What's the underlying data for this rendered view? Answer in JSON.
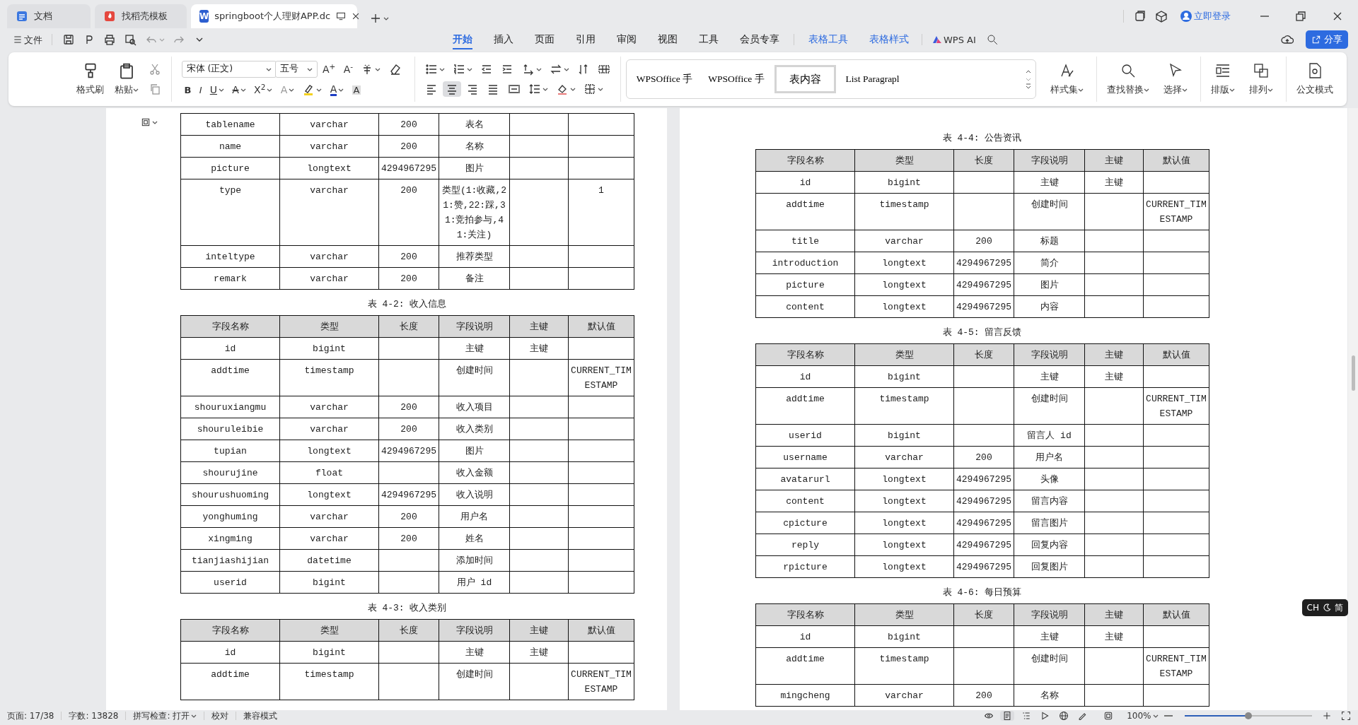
{
  "tabs": [
    {
      "label": "文档",
      "kind": "docs",
      "selected": false
    },
    {
      "label": "找稻壳模板",
      "kind": "docer",
      "selected": false
    },
    {
      "label": "springboot个人理财APP.dc",
      "kind": "word",
      "badge": "W",
      "selected": true
    }
  ],
  "account": {
    "login": "立即登录"
  },
  "file_menu": "文件",
  "menu_tabs": [
    {
      "label": "开始",
      "kind": "main",
      "selected": true
    },
    {
      "label": "插入",
      "kind": "main",
      "selected": false
    },
    {
      "label": "页面",
      "kind": "main",
      "selected": false
    },
    {
      "label": "引用",
      "kind": "main",
      "selected": false
    },
    {
      "label": "审阅",
      "kind": "main",
      "selected": false
    },
    {
      "label": "视图",
      "kind": "main",
      "selected": false
    },
    {
      "label": "工具",
      "kind": "main",
      "selected": false
    },
    {
      "label": "会员专享",
      "kind": "main",
      "selected": false
    },
    {
      "label": "表格工具",
      "kind": "context",
      "selected": false
    },
    {
      "label": "表格样式",
      "kind": "context",
      "selected": false
    }
  ],
  "ai": "WPS AI",
  "share": "分享",
  "ribbon": {
    "format_painter": "格式刷",
    "paste": "粘贴",
    "font_family": "宋体 (正文)",
    "font_size": "五号",
    "font_row1": [
      {
        "kind": "grow",
        "glyph": "A$^{+}$",
        "dropdown": false
      },
      {
        "kind": "shrink",
        "glyph": "A$^{-}$",
        "dropdown": false
      },
      {
        "kind": "phonetic",
        "dropdown": true
      },
      {
        "kind": "eraser",
        "dropdown": false
      }
    ],
    "font_row2": [
      {
        "kind": "bold",
        "glyph": "B",
        "dropdown": false
      },
      {
        "kind": "italic",
        "glyph": "I",
        "dropdown": false
      },
      {
        "kind": "underline",
        "glyph": "U",
        "dropdown": true
      },
      {
        "kind": "strike",
        "glyph": "A",
        "dropdown": true
      },
      {
        "kind": "superscript",
        "glyph": "X$^{2}$",
        "dropdown": true
      },
      {
        "kind": "effects",
        "glyph": "A",
        "dropdown": true
      },
      {
        "kind": "highlight",
        "dropdown": true
      },
      {
        "kind": "font-color",
        "glyph": "A",
        "dropdown": true
      },
      {
        "kind": "shading",
        "glyph": "A",
        "dropdown": false
      }
    ],
    "para_row1": [
      {
        "kind": "bullets",
        "dropdown": true
      },
      {
        "kind": "numbering",
        "dropdown": true
      },
      {
        "kind": "outdent",
        "dropdown": false
      },
      {
        "kind": "indent",
        "dropdown": false
      },
      {
        "kind": "text-direction",
        "dropdown": true
      },
      {
        "kind": "swap",
        "dropdown": true
      },
      {
        "kind": "sort",
        "dropdown": false
      },
      {
        "kind": "table-grid",
        "dropdown": false
      }
    ],
    "para_row2": [
      {
        "kind": "align-left",
        "dropdown": false,
        "selected": false
      },
      {
        "kind": "align-center",
        "dropdown": false,
        "selected": true
      },
      {
        "kind": "align-right",
        "dropdown": false,
        "selected": false
      },
      {
        "kind": "justify",
        "dropdown": false,
        "selected": false
      },
      {
        "kind": "distribute",
        "dropdown": false,
        "selected": false
      },
      {
        "kind": "line-spacing",
        "dropdown": true,
        "selected": false
      },
      {
        "kind": "fill",
        "dropdown": true,
        "selected": false
      },
      {
        "kind": "border",
        "dropdown": true,
        "selected": false
      }
    ],
    "styles": [
      {
        "label": "WPSOffice 手",
        "selected": false
      },
      {
        "label": "WPSOffice 手",
        "selected": false
      },
      {
        "label": "表内容",
        "selected": true
      },
      {
        "label": "List Paragrapl",
        "selected": false
      }
    ],
    "big_tools": [
      {
        "kind": "style-set",
        "label": "样式集",
        "dropdown": true
      },
      {
        "kind": "find-replace",
        "label": "查找替换",
        "dropdown": true
      },
      {
        "kind": "select",
        "label": "选择",
        "dropdown": true
      },
      {
        "kind": "layout",
        "label": "排版",
        "dropdown": true
      },
      {
        "kind": "arrange",
        "label": "排列",
        "dropdown": true
      },
      {
        "kind": "official",
        "label": "公文模式",
        "dropdown": false
      }
    ]
  },
  "pages": [
    {
      "blocks": [
        {
          "kind": "table",
          "rows": [
            [
              "tablename",
              "varchar",
              "200",
              "表名",
              null,
              null
            ],
            [
              "name",
              "varchar",
              "200",
              "名称",
              null,
              null
            ],
            [
              "picture",
              "longtext",
              "4294967295",
              "图片",
              null,
              null
            ],
            [
              "type",
              "varchar",
              "200",
              "类型(1:收藏,21:赞,22:踩,31:竞拍参与,41:关注)",
              null,
              "1"
            ],
            [
              "inteltype",
              "varchar",
              "200",
              "推荐类型",
              null,
              null
            ],
            [
              "remark",
              "varchar",
              "200",
              "备注",
              null,
              null
            ]
          ]
        },
        {
          "kind": "caption",
          "text": "表 4-2: 收入信息"
        },
        {
          "kind": "table",
          "columns": [
            "字段名称",
            "类型",
            "长度",
            "字段说明",
            "主键",
            "默认值"
          ],
          "rows": [
            [
              "id",
              "bigint",
              null,
              "主键",
              "主键",
              null
            ],
            [
              "addtime",
              "timestamp",
              null,
              "创建时间",
              null,
              "CURRENT_TIMESTAMP"
            ],
            [
              "shouruxiangmu",
              "varchar",
              "200",
              "收入项目",
              null,
              null
            ],
            [
              "shouruleibie",
              "varchar",
              "200",
              "收入类别",
              null,
              null
            ],
            [
              "tupian",
              "longtext",
              "4294967295",
              "图片",
              null,
              null
            ],
            [
              "shourujine",
              "float",
              null,
              "收入金额",
              null,
              null
            ],
            [
              "shourushuoming",
              "longtext",
              "4294967295",
              "收入说明",
              null,
              null
            ],
            [
              "yonghuming",
              "varchar",
              "200",
              "用户名",
              null,
              null
            ],
            [
              "xingming",
              "varchar",
              "200",
              "姓名",
              null,
              null
            ],
            [
              "tianjiashijian",
              "datetime",
              null,
              "添加时间",
              null,
              null
            ],
            [
              "userid",
              "bigint",
              null,
              "用户 id",
              null,
              null
            ]
          ]
        },
        {
          "kind": "caption",
          "text": "表 4-3: 收入类别"
        },
        {
          "kind": "table",
          "columns": [
            "字段名称",
            "类型",
            "长度",
            "字段说明",
            "主键",
            "默认值"
          ],
          "rows": [
            [
              "id",
              "bigint",
              null,
              "主键",
              "主键",
              null
            ],
            [
              "addtime",
              "timestamp",
              null,
              "创建时间",
              null,
              "CURRENT_TIMESTAMP"
            ]
          ]
        }
      ]
    },
    {
      "blocks": [
        {
          "kind": "caption",
          "text": "表 4-4: 公告资讯"
        },
        {
          "kind": "table",
          "columns": [
            "字段名称",
            "类型",
            "长度",
            "字段说明",
            "主键",
            "默认值"
          ],
          "rows": [
            [
              "id",
              "bigint",
              null,
              "主键",
              "主键",
              null
            ],
            [
              "addtime",
              "timestamp",
              null,
              "创建时间",
              null,
              "CURRENT_TIMESTAMP"
            ],
            [
              "title",
              "varchar",
              "200",
              "标题",
              null,
              null
            ],
            [
              "introduction",
              "longtext",
              "4294967295",
              "简介",
              null,
              null
            ],
            [
              "picture",
              "longtext",
              "4294967295",
              "图片",
              null,
              null
            ],
            [
              "content",
              "longtext",
              "4294967295",
              "内容",
              null,
              null
            ]
          ]
        },
        {
          "kind": "caption",
          "text": "表 4-5: 留言反馈"
        },
        {
          "kind": "table",
          "columns": [
            "字段名称",
            "类型",
            "长度",
            "字段说明",
            "主键",
            "默认值"
          ],
          "rows": [
            [
              "id",
              "bigint",
              null,
              "主键",
              "主键",
              null
            ],
            [
              "addtime",
              "timestamp",
              null,
              "创建时间",
              null,
              "CURRENT_TIMESTAMP"
            ],
            [
              "userid",
              "bigint",
              null,
              "留言人 id",
              null,
              null
            ],
            [
              "username",
              "varchar",
              "200",
              "用户名",
              null,
              null
            ],
            [
              "avatarurl",
              "longtext",
              "4294967295",
              "头像",
              null,
              null
            ],
            [
              "content",
              "longtext",
              "4294967295",
              "留言内容",
              null,
              null
            ],
            [
              "cpicture",
              "longtext",
              "4294967295",
              "留言图片",
              null,
              null
            ],
            [
              "reply",
              "longtext",
              "4294967295",
              "回复内容",
              null,
              null
            ],
            [
              "rpicture",
              "longtext",
              "4294967295",
              "回复图片",
              null,
              null
            ]
          ]
        },
        {
          "kind": "caption",
          "text": "表 4-6: 每日预算"
        },
        {
          "kind": "table",
          "columns": [
            "字段名称",
            "类型",
            "长度",
            "字段说明",
            "主键",
            "默认值"
          ],
          "rows": [
            [
              "id",
              "bigint",
              null,
              "主键",
              "主键",
              null
            ],
            [
              "addtime",
              "timestamp",
              null,
              "创建时间",
              null,
              "CURRENT_TIMESTAMP"
            ],
            [
              "mingcheng",
              "varchar",
              "200",
              "名称",
              null,
              null
            ]
          ]
        }
      ]
    }
  ],
  "ime": {
    "label": "CH",
    "mode": "简"
  },
  "status": {
    "page": "页面: 17/38",
    "words": "字数: 13828",
    "spell": "拼写检查: 打开",
    "proof": "校对",
    "compat": "兼容模式",
    "views": [
      {
        "kind": "read",
        "selected": false
      },
      {
        "kind": "page",
        "selected": true
      },
      {
        "kind": "outline",
        "selected": false
      },
      {
        "kind": "play",
        "selected": false
      },
      {
        "kind": "web",
        "selected": false
      },
      {
        "kind": "pen",
        "selected": false
      }
    ],
    "zoom": "100%",
    "zoom_slider": {
      "level": 0.5
    }
  }
}
